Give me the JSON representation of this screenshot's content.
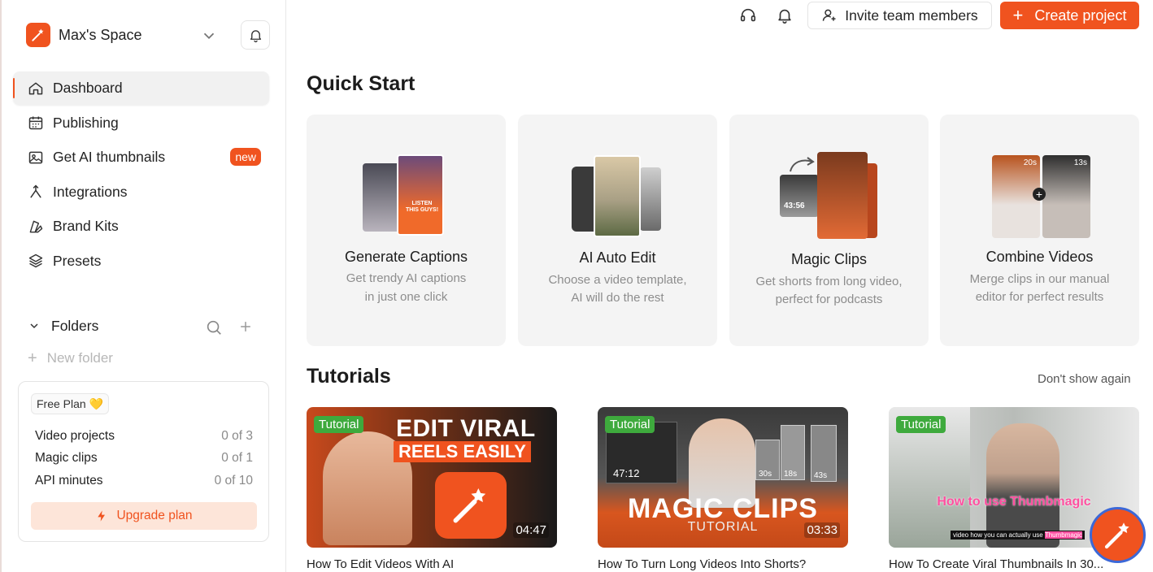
{
  "workspace": {
    "name": "Max's Space"
  },
  "nav": {
    "items": [
      {
        "label": "Dashboard"
      },
      {
        "label": "Publishing"
      },
      {
        "label": "Get AI thumbnails",
        "badge": "new"
      },
      {
        "label": "Integrations"
      },
      {
        "label": "Brand Kits"
      },
      {
        "label": "Presets"
      }
    ]
  },
  "folders": {
    "label": "Folders",
    "new_folder": "New folder"
  },
  "plan": {
    "badge": "Free Plan 💛",
    "rows": [
      {
        "label": "Video projects",
        "value": "0 of 3"
      },
      {
        "label": "Magic clips",
        "value": "0 of 1"
      },
      {
        "label": "API minutes",
        "value": "0 of 10"
      }
    ],
    "upgrade": "Upgrade plan"
  },
  "topbar": {
    "invite": "Invite team members",
    "create": "Create project",
    "create_plus": "+"
  },
  "quick_start": {
    "title": "Quick Start",
    "cards": [
      {
        "title": "Generate Captions",
        "desc1": "Get trendy AI captions",
        "desc2": "in just one click",
        "thumb_text": "LISTEN THIS GUYS!"
      },
      {
        "title": "AI Auto Edit",
        "desc1": "Choose a video template,",
        "desc2": "AI will do the rest"
      },
      {
        "title": "Magic Clips",
        "desc1": "Get shorts from long video,",
        "desc2": "perfect for podcasts",
        "thumb_time": "43:56"
      },
      {
        "title": "Combine Videos",
        "desc1": "Merge clips in our manual",
        "desc2": "editor for perfect results",
        "clip1": "20s",
        "clip2": "13s"
      }
    ]
  },
  "tutorials": {
    "title": "Tutorials",
    "dont_show": "Don't show again",
    "items": [
      {
        "tag": "Tutorial",
        "duration": "04:47",
        "title": "How To Edit Videos With AI",
        "overlay1": "EDIT VIRAL",
        "overlay2": "REELS EASILY"
      },
      {
        "tag": "Tutorial",
        "duration": "03:33",
        "title": "How To Turn Long Videos Into Shorts?",
        "overlay1": "MAGIC CLIPS",
        "overlay2": "TUTORIAL",
        "inner_time": "47:12",
        "chips": [
          "30s",
          "18s",
          "43s"
        ]
      },
      {
        "tag": "Tutorial",
        "title": "How To Create Viral Thumbnails In 30...",
        "overlay1": "How to use Thumbmagic",
        "subtitle_text": "video how you can actually use",
        "subtitle_highlight": "Thumbmagic"
      }
    ]
  },
  "colors": {
    "accent": "#f0531f",
    "tag_green": "#3eaa3d",
    "card_bg": "#f4f4f4"
  }
}
